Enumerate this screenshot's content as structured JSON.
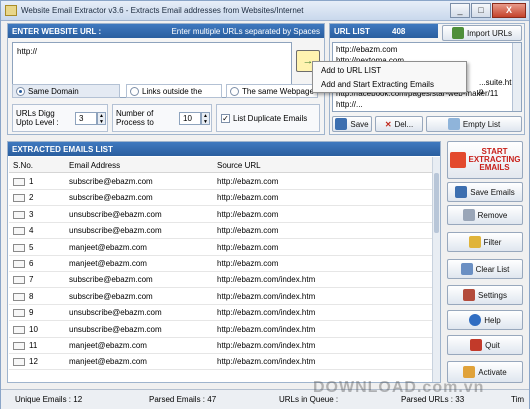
{
  "window": {
    "title": "Website Email Extractor v3.6 - Extracts Email addresses from Websites/Internet",
    "min": "_",
    "max": "□",
    "close": "X"
  },
  "url_input": {
    "header": "ENTER WEBSITE URL :",
    "hint": "Enter multiple URLs separated by Spaces",
    "value": "http://",
    "go_arrow": "→"
  },
  "options": {
    "same_domain": "Same Domain",
    "links_outside": "Links outside the",
    "same_webpage": "The same Webpage",
    "urls_digg_label1": "URLs Digg",
    "urls_digg_label2": "Upto Level :",
    "urls_digg_value": "3",
    "processes_label1": "Number of",
    "processes_label2": "Process to",
    "processes_value": "10",
    "list_duplicate": "List Duplicate Emails",
    "check_mark": "✓"
  },
  "url_list": {
    "header": "URL LIST",
    "count": "408",
    "import_label": "Import URLs",
    "items": [
      "http://ebazm.com",
      "http://nextoma.com",
      "",
      "...suite.html?p",
      "http://facebook.com/pages/star-web-maker/11",
      "http://..."
    ],
    "save_label": "Save",
    "delete_label": "Del...",
    "empty_label": "Empty List"
  },
  "context_menu": {
    "item1": "Add to URL LIST",
    "item2": "Add and Start Extracting Emails"
  },
  "emails": {
    "header": "EXTRACTED EMAILS LIST",
    "columns": [
      "S.No.",
      "Email Address",
      "Source URL"
    ],
    "rows": [
      [
        "1",
        "subscribe@ebazm.com",
        "http://ebazm.com"
      ],
      [
        "2",
        "subscribe@ebazm.com",
        "http://ebazm.com"
      ],
      [
        "3",
        "unsubscribe@ebazm.com",
        "http://ebazm.com"
      ],
      [
        "4",
        "unsubscribe@ebazm.com",
        "http://ebazm.com"
      ],
      [
        "5",
        "manjeet@ebazm.com",
        "http://ebazm.com"
      ],
      [
        "6",
        "manjeet@ebazm.com",
        "http://ebazm.com"
      ],
      [
        "7",
        "subscribe@ebazm.com",
        "http://ebazm.com/index.htm"
      ],
      [
        "8",
        "subscribe@ebazm.com",
        "http://ebazm.com/index.htm"
      ],
      [
        "9",
        "unsubscribe@ebazm.com",
        "http://ebazm.com/index.htm"
      ],
      [
        "10",
        "unsubscribe@ebazm.com",
        "http://ebazm.com/index.htm"
      ],
      [
        "11",
        "manjeet@ebazm.com",
        "http://ebazm.com/index.htm"
      ],
      [
        "12",
        "manjeet@ebazm.com",
        "http://ebazm.com/index.htm"
      ]
    ]
  },
  "actions": {
    "start_line1": "START",
    "start_line2": "EXTRACTING",
    "start_line3": "EMAILS",
    "save_emails": "Save Emails",
    "remove": "Remove",
    "filter": "Filter",
    "clear_list": "Clear List",
    "settings": "Settings",
    "help": "Help",
    "quit": "Quit",
    "activate": "Activate"
  },
  "status": {
    "unique": "Unique Emails : 12",
    "parsed": "Parsed Emails : 47",
    "queue": "URLs in Queue :",
    "parsed_urls": "Parsed URLs : 33",
    "time": "Tim"
  },
  "watermark": "DOWNLOAD.com.vn"
}
